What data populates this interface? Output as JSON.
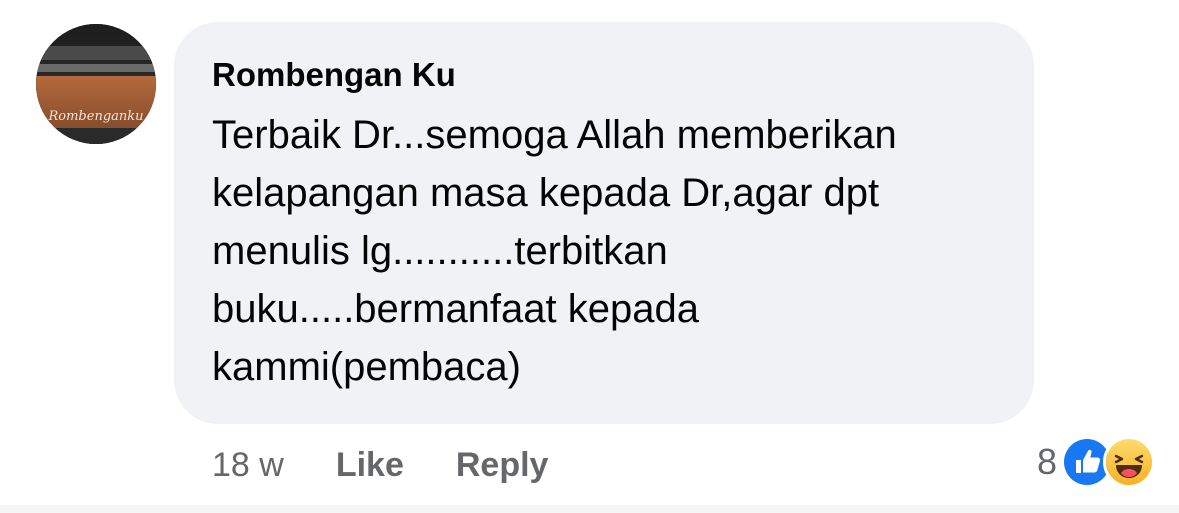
{
  "comment": {
    "avatar": {
      "icon": "profile-avatar",
      "text": "Rombenganku"
    },
    "author": "Rombengan Ku",
    "lines": [
      "Terbaik Dr...semoga Allah memberikan",
      "kelapangan masa kepada Dr,agar dpt",
      "menulis lg...........terbitkan",
      "buku.....bermanfaat kepada",
      "kammi(pembaca)"
    ],
    "timestamp": "18 w",
    "like_label": "Like",
    "reply_label": "Reply",
    "reactions": {
      "count": "8",
      "icons": [
        "like-icon",
        "haha-icon"
      ],
      "colors": {
        "like": "#1877f2",
        "haha": "#f7b125"
      }
    }
  },
  "colors": {
    "bubble": "#f0f2f5",
    "text": "#050505",
    "secondary": "#65676b"
  }
}
